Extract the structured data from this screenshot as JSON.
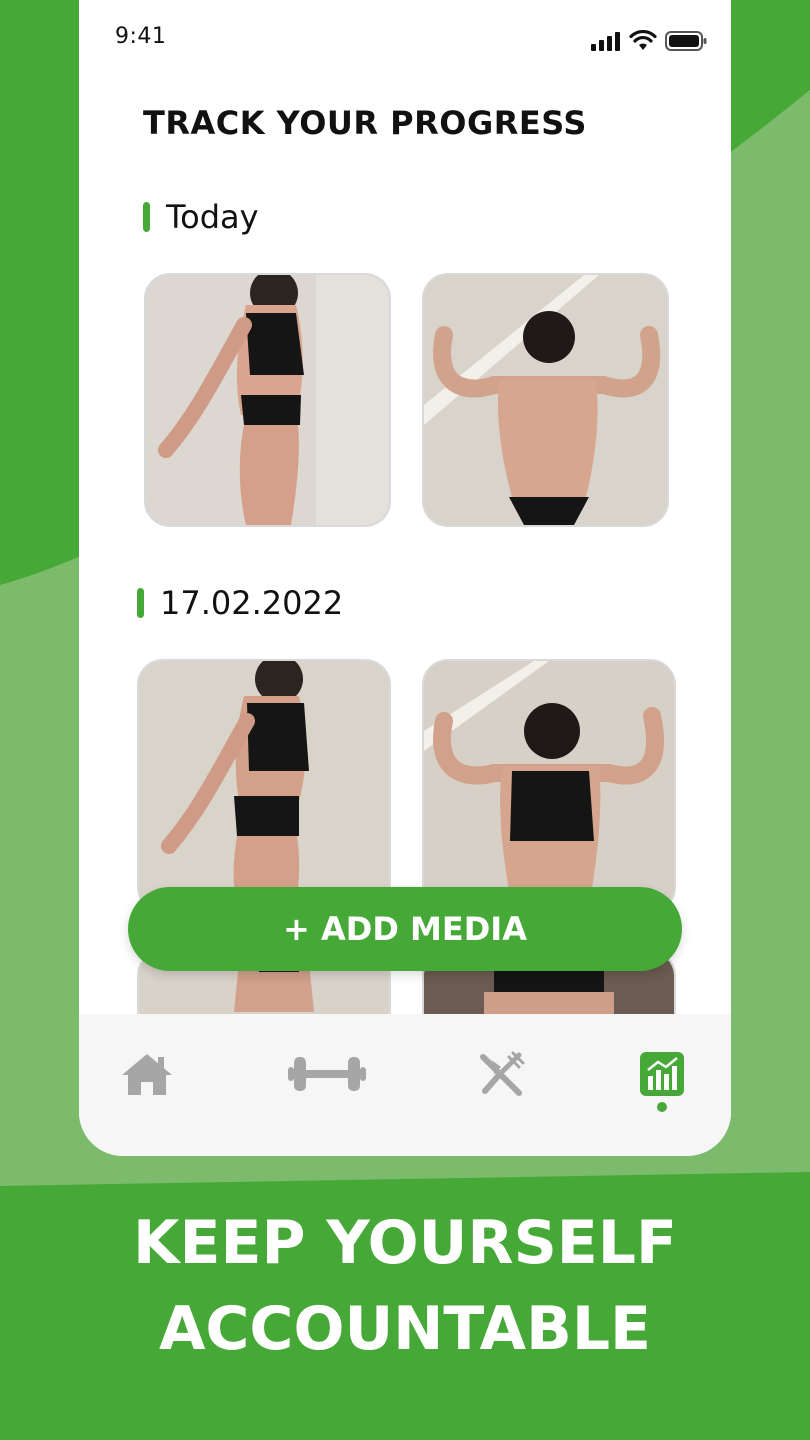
{
  "status_bar": {
    "time": "9:41"
  },
  "page": {
    "title": "TRACK YOUR PROGRESS"
  },
  "sections": [
    {
      "label": "Today"
    },
    {
      "label": "17.02.2022"
    }
  ],
  "add_media_button": {
    "label": "+ ADD MEDIA"
  },
  "bottom_nav": {
    "items": [
      {
        "icon": "home-icon",
        "active": false
      },
      {
        "icon": "dumbbell-icon",
        "active": false
      },
      {
        "icon": "fork-knife-icon",
        "active": false
      },
      {
        "icon": "progress-chart-icon",
        "active": true
      }
    ]
  },
  "headline": {
    "line1": "KEEP YOURSELF",
    "line2": "ACCOUNTABLE"
  },
  "colors": {
    "brand_green": "#46a836",
    "light_green": "#7bbb6b",
    "inactive_icon": "#a6a6a6"
  }
}
